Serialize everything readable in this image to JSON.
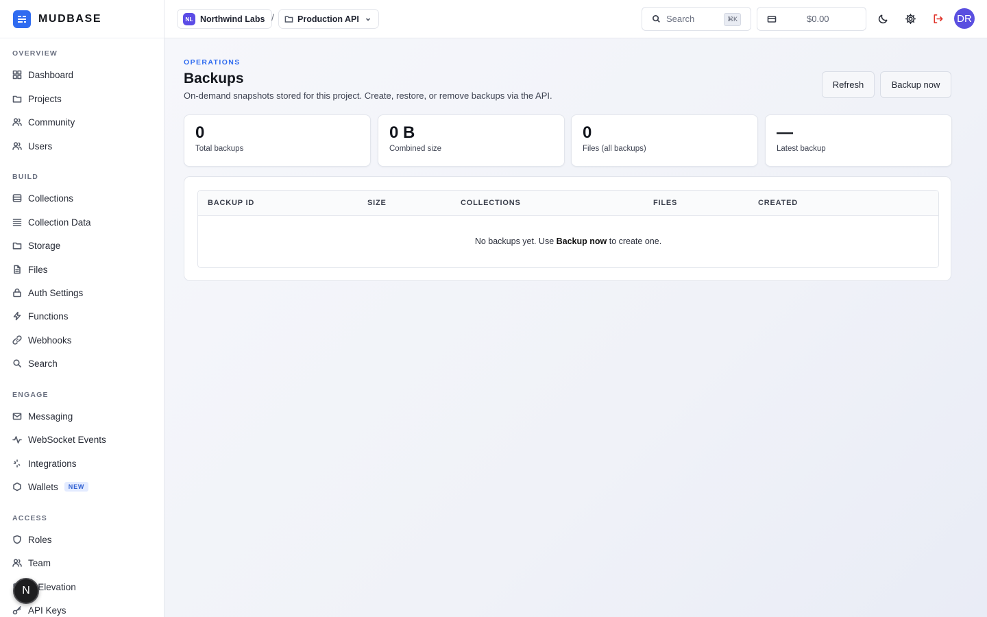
{
  "brand": {
    "name": "MUDBASE"
  },
  "sidebar": {
    "sections": [
      {
        "label": "OVERVIEW",
        "items": [
          {
            "label": "Dashboard",
            "icon": "grid-icon"
          },
          {
            "label": "Projects",
            "icon": "folder-icon"
          },
          {
            "label": "Community",
            "icon": "users-icon"
          },
          {
            "label": "Users",
            "icon": "users-icon"
          }
        ]
      },
      {
        "label": "BUILD",
        "items": [
          {
            "label": "Collections",
            "icon": "database-icon"
          },
          {
            "label": "Collection Data",
            "icon": "list-icon"
          },
          {
            "label": "Storage",
            "icon": "folder-icon"
          },
          {
            "label": "Files",
            "icon": "file-icon"
          },
          {
            "label": "Auth Settings",
            "icon": "lock-icon"
          },
          {
            "label": "Functions",
            "icon": "bolt-icon"
          },
          {
            "label": "Webhooks",
            "icon": "link-icon"
          },
          {
            "label": "Search",
            "icon": "search-icon"
          }
        ]
      },
      {
        "label": "ENGAGE",
        "items": [
          {
            "label": "Messaging",
            "icon": "mail-icon"
          },
          {
            "label": "WebSocket Events",
            "icon": "activity-icon"
          },
          {
            "label": "Integrations",
            "icon": "sparkle-icon"
          },
          {
            "label": "Wallets",
            "icon": "hexagon-icon",
            "badge": "NEW"
          }
        ]
      },
      {
        "label": "ACCESS",
        "items": [
          {
            "label": "Roles",
            "icon": "shield-icon"
          },
          {
            "label": "Team",
            "icon": "users-icon"
          },
          {
            "label": "le Elevation",
            "icon": "shield-icon"
          },
          {
            "label": "API Keys",
            "icon": "key-icon"
          }
        ]
      }
    ],
    "floating_button": "N"
  },
  "topbar": {
    "org": {
      "initials": "NL",
      "name": "Northwind Labs"
    },
    "separator": "/",
    "project": {
      "name": "Production API"
    },
    "search": {
      "placeholder": "Search",
      "shortcut": "⌘K"
    },
    "wallet": {
      "amount": "$0.00"
    },
    "user_initials": "DR"
  },
  "page": {
    "eyebrow": "OPERATIONS",
    "title": "Backups",
    "description": "On-demand snapshots stored for this project. Create, restore, or remove backups via the API.",
    "refresh_label": "Refresh",
    "backup_label": "Backup now",
    "stats": [
      {
        "value": "0",
        "label": "Total backups"
      },
      {
        "value": "0 B",
        "label": "Combined size"
      },
      {
        "value": "0",
        "label": "Files (all backups)"
      },
      {
        "value": "—",
        "label": "Latest backup"
      }
    ],
    "table": {
      "columns": [
        "BACKUP ID",
        "SIZE",
        "COLLECTIONS",
        "FILES",
        "CREATED"
      ],
      "empty": {
        "before": "No backups yet. Use ",
        "bold": "Backup now",
        "after": " to create one."
      }
    }
  },
  "colors": {
    "accent": "#2f6bf0",
    "avatar": "#5a4fe0",
    "logout": "#e0342b"
  }
}
